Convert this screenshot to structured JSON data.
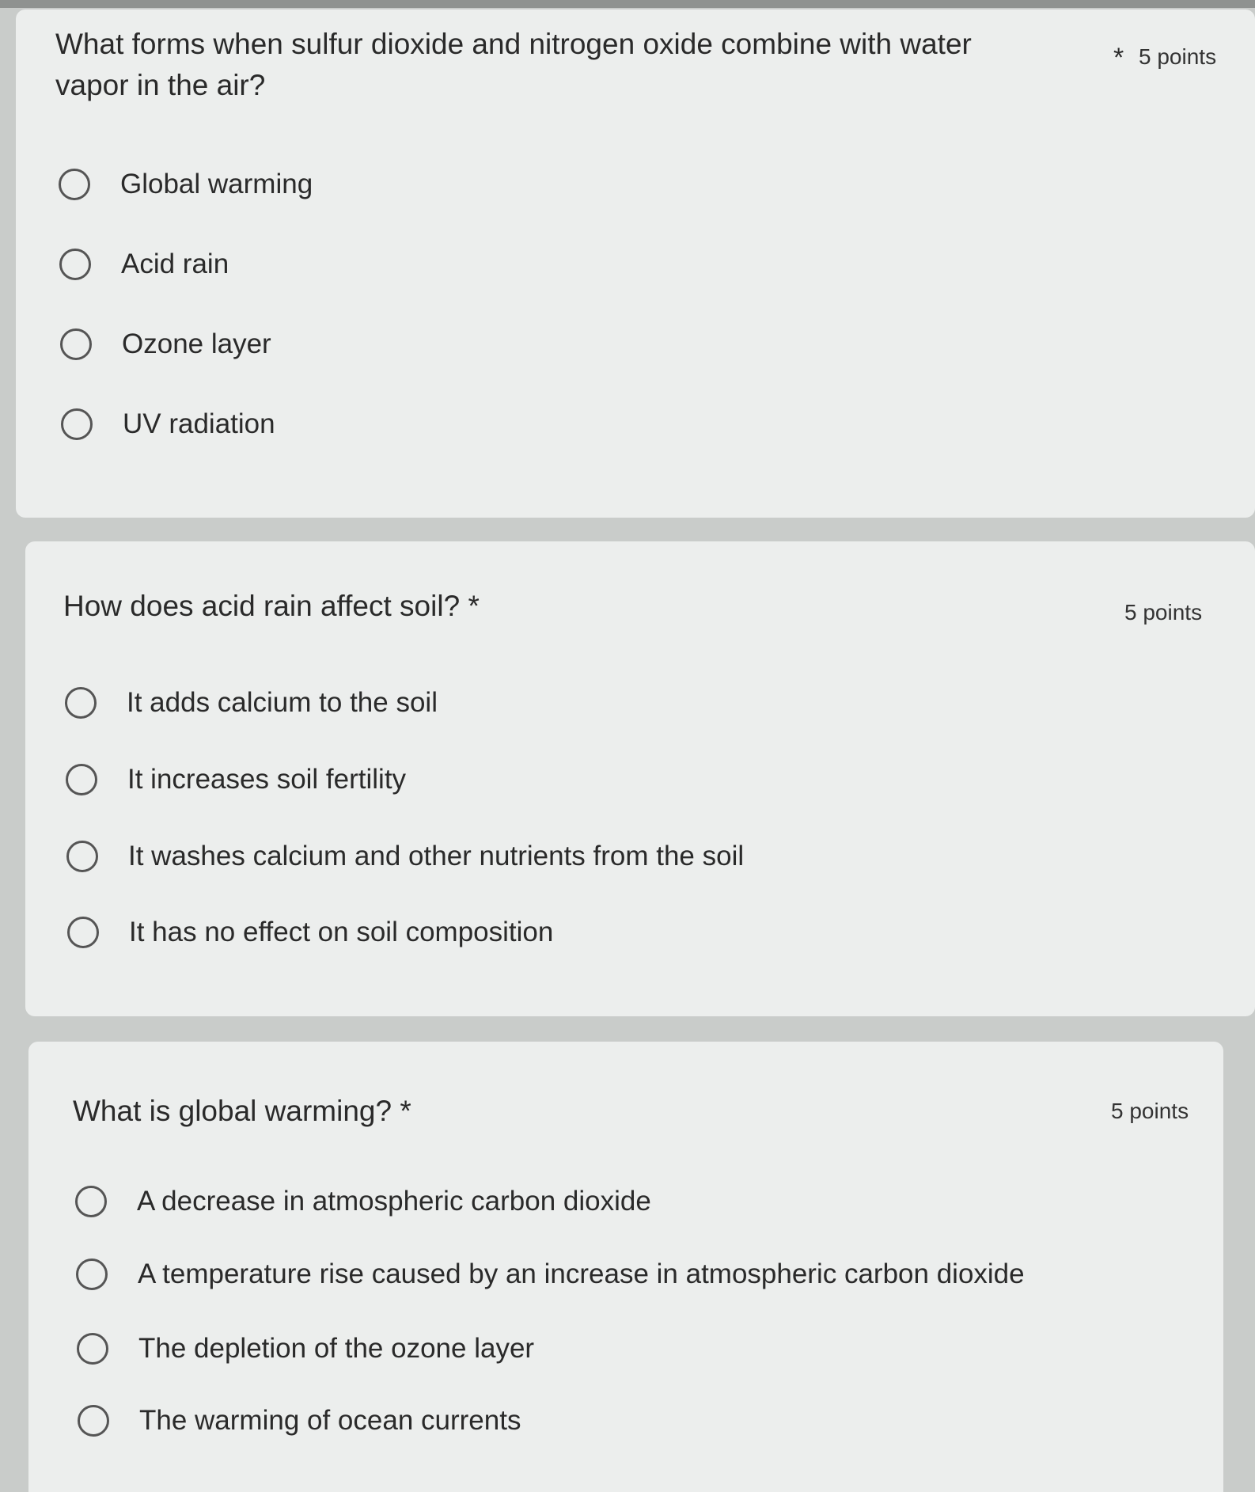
{
  "questions": [
    {
      "title_line1": "What forms when sulfur dioxide and nitrogen oxide combine with water",
      "title_line2": "vapor in the air?",
      "required_mark": "*",
      "points": "5 points",
      "options": [
        "Global warming",
        "Acid rain",
        "Ozone layer",
        "UV radiation"
      ]
    },
    {
      "title": "How does acid rain affect soil?",
      "required_mark": "*",
      "points": "5 points",
      "options": [
        "It adds calcium to the soil",
        "It increases soil fertility",
        "It washes calcium and other nutrients from the soil",
        "It has no effect on soil composition"
      ]
    },
    {
      "title": "What is global warming?",
      "required_mark": "*",
      "points": "5 points",
      "options": [
        "A decrease in atmospheric carbon dioxide",
        "A temperature rise caused by an increase in atmospheric carbon dioxide",
        "The depletion of the ozone layer",
        "The warming of ocean currents"
      ]
    }
  ]
}
